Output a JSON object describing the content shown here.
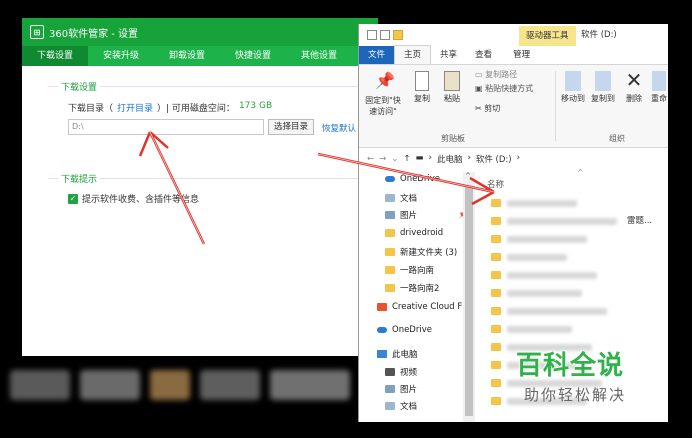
{
  "app360": {
    "title": "360软件管家 - 设置",
    "tabs": [
      "下载设置",
      "安装升级",
      "卸载设置",
      "快捷设置",
      "其他设置"
    ],
    "download_section": {
      "title": "下载设置",
      "dir_label": "下载目录（",
      "open_dir_link": "打开目录",
      "space_label": "）| 可用磁盘空间：",
      "space_value": "173 GB",
      "path_value": "D:\\",
      "choose_button": "选择目录",
      "restore_link": "恢复默认"
    },
    "tips_section": {
      "title": "下载提示",
      "checkbox_label": "提示软件收费、含插件等信息"
    }
  },
  "explorer": {
    "drive_tools_tab": "驱动器工具",
    "drive_name": "软件 (D:)",
    "ribbon_tabs": [
      "文件",
      "主页",
      "共享",
      "查看",
      "管理"
    ],
    "ribbon": {
      "pin_label": "固定到\"快\n速访问\"",
      "copy_label": "复制",
      "paste_label": "粘贴",
      "copy_path": "复制路径",
      "paste_shortcut": "粘贴快捷方式",
      "cut_label": "剪切",
      "clipboard_group": "剪贴板",
      "move_to": "移动到",
      "copy_to": "复制到",
      "delete_label": "删除",
      "rename_label": "重命",
      "organize_group": "组织"
    },
    "address": [
      "此电脑",
      "软件 (D:)"
    ],
    "nav_items": [
      "OneDrive",
      "文档",
      "图片",
      "drivedroid",
      "新建文件夹 (3)",
      "一路向南",
      "一路向南2",
      "Creative Cloud F",
      "OneDrive",
      "此电脑",
      "视频",
      "图片",
      "文档"
    ],
    "column_name": "名称",
    "tail_text": "雷题..."
  },
  "watermark": {
    "main": "百科全说",
    "sub": "助你轻松解决"
  },
  "colors": {
    "brand_green": "#15a33a",
    "arrow_red": "#e0342c",
    "explorer_blue": "#1e66b9"
  }
}
